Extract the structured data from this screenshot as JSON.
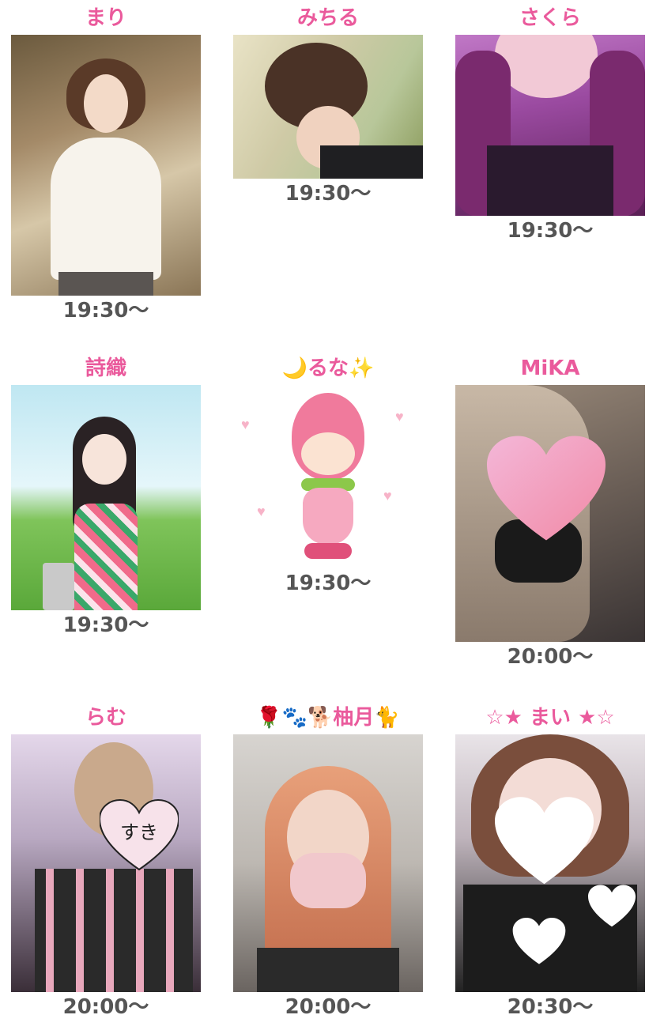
{
  "cast": [
    {
      "name": "まり",
      "time": "19:30〜"
    },
    {
      "name": "みちる",
      "time": "19:30〜"
    },
    {
      "name": "さくら",
      "time": "19:30〜"
    },
    {
      "name": "詩織",
      "time": "19:30〜"
    },
    {
      "name": "🌙るな✨",
      "time": "19:30〜"
    },
    {
      "name": "MiKA",
      "time": "20:00〜"
    },
    {
      "name": "らむ",
      "time": "20:00〜"
    },
    {
      "name": "🌹🐾🐕柚月🐈",
      "time": "20:00〜"
    },
    {
      "name": "☆★ まい ★☆",
      "time": "20:30〜"
    }
  ],
  "stickers": {
    "ramu_heart_text": "すき"
  },
  "colors": {
    "name_pink": "#ea5a9c",
    "time_gray": "#555555"
  }
}
